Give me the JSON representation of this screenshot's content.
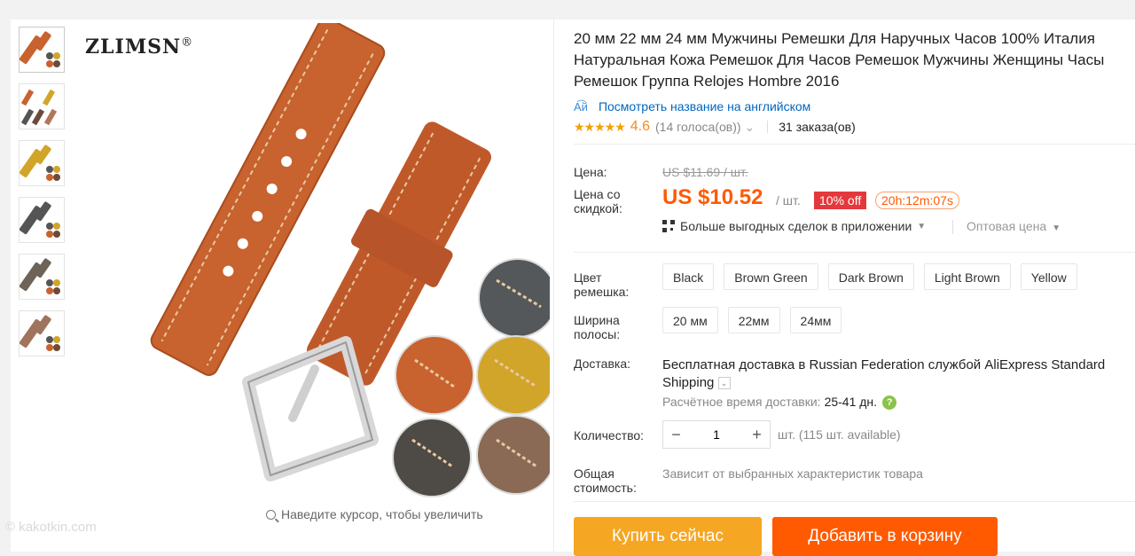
{
  "gallery": {
    "brand": "ZLIMSN",
    "brand_mark": "®",
    "zoom_hint": "Наведите курсор, чтобы увеличить",
    "thumbnails": [
      "brown",
      "mixed",
      "yellow",
      "black",
      "dark-brown",
      "light-brown"
    ]
  },
  "watermark": "© kakotkin.com",
  "product": {
    "title": "20 мм 22 мм 24 мм Мужчины Ремешки Для Наручных Часов 100% Италия Натуральная Кожа Ремешок Для Часов Ремешок Мужчины Женщины Часы Ремешок Группа Relojes Hombre 2016",
    "translate_link": "Посмотреть название на английском",
    "rating": "4.6",
    "stars": "★★★★★",
    "votes": "(14 голоса(ов))",
    "orders": "31 заказа(ов)"
  },
  "price": {
    "label": "Цена:",
    "old": "US $11.69 / шт.",
    "discount_label_1": "Цена со",
    "discount_label_2": "скидкой:",
    "new": "US $10.52",
    "unit": "/ шт.",
    "discount": "10% off",
    "timer": "20h:12m:07s",
    "app_deals": "Больше выгодных сделок в приложении",
    "wholesale": "Оптовая цена"
  },
  "options": {
    "color_label_1": "Цвет",
    "color_label_2": "ремешка:",
    "colors": [
      "Black",
      "Brown Green",
      "Dark Brown",
      "Light Brown",
      "Yellow"
    ],
    "width_label_1": "Ширина",
    "width_label_2": "полосы:",
    "widths": [
      "20 мм",
      "22мм",
      "24мм"
    ]
  },
  "shipping": {
    "label": "Доставка:",
    "text_bold": "Бесплатная доставка в",
    "text_rest": " Russian Federation службой AliExpress Standard Shipping",
    "time_label": "Расчётное время доставки:",
    "time_value": "25-41 дн."
  },
  "quantity": {
    "label": "Количество:",
    "value": "1",
    "available": "шт. (115 шт. available)"
  },
  "total": {
    "label_1": "Общая",
    "label_2": "стоимость:",
    "value": "Зависит от выбранных характеристик товара"
  },
  "buttons": {
    "buy": "Купить сейчас",
    "cart": "Добавить в корзину"
  },
  "colors": {
    "price": "#ff5a00",
    "discount_badge": "#e4393c",
    "buy_button": "#f5a623",
    "cart_button": "#ff5a00",
    "link": "#0066c0",
    "leather": "#c8622e"
  }
}
